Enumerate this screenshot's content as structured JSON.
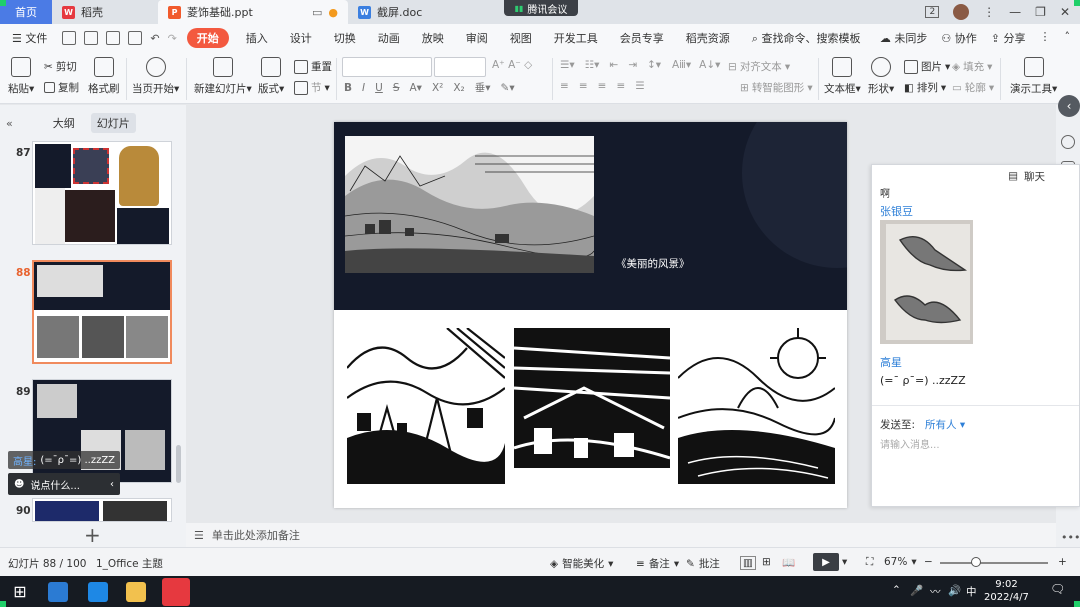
{
  "titlebar": {
    "home_tab": "首页",
    "tab_wps": "稻壳",
    "tab_ppt": "菱饰基础.ppt",
    "tab_doc": "截屏.doc",
    "meeting": "腾讯会议",
    "window_badge": "2"
  },
  "menu": {
    "file": "文件",
    "start": "开始",
    "items": [
      "插入",
      "设计",
      "切换",
      "动画",
      "放映",
      "审阅",
      "视图",
      "开发工具",
      "会员专享",
      "稻壳资源"
    ],
    "search": "查找命令、搜索模板",
    "sync": "未同步",
    "collab": "协作",
    "share": "分享"
  },
  "ribbon": {
    "paste": "粘贴",
    "cut": "剪切",
    "copy": "复制",
    "format_painter": "格式刷",
    "from_start": "当页开始",
    "new_slide": "新建幻灯片",
    "layout": "版式",
    "section": "节",
    "reset": "重置",
    "align_text": "对齐文本",
    "smart_shape": "转智能图形",
    "textbox": "文本框",
    "shape": "形状",
    "picture": "图片",
    "fill": "填充",
    "arrange": "排列",
    "outline": "轮廓",
    "present_tools": "演示工具"
  },
  "left_panel": {
    "outline_tab": "大纲",
    "slides_tab": "幻灯片",
    "slide_numbers": [
      "87",
      "88",
      "89",
      "90"
    ],
    "chat_popup_name": "高星:",
    "chat_popup_text": "(=¯ρ¯=) ..zzZZ",
    "say_something": "说点什么..."
  },
  "slide": {
    "title": "《美丽的风景》"
  },
  "notes": {
    "placeholder": "单击此处添加备注"
  },
  "chat": {
    "title": "聊天",
    "partial_text": "啊",
    "user1": "张银豆",
    "user2": "高星",
    "message2": "(=¯ ρ¯=) ..zzZZ",
    "send_to_label": "发送至:",
    "send_to_value": "所有人",
    "input_placeholder": "请输入消息..."
  },
  "status": {
    "slide_count": "幻灯片 88 / 100",
    "theme": "1_Office 主题",
    "beautify": "智能美化",
    "notes": "备注",
    "comments": "批注",
    "zoom": "67%",
    "zoom_level": 0.33
  },
  "taskbar": {
    "ime": "中",
    "time": "9:02",
    "date": "2022/4/7"
  },
  "colors": {
    "accent_orange": "#f3593f",
    "home_blue": "#4b7be5",
    "link_blue": "#2f80d8",
    "slide_dark": "#141a2a"
  }
}
